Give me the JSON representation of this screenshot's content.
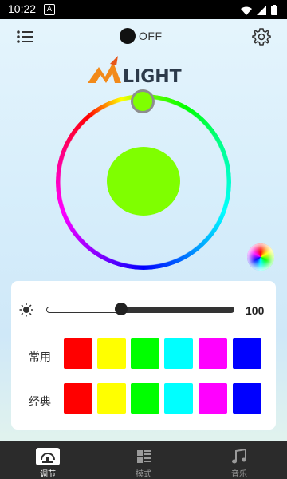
{
  "status_bar": {
    "time": "10:22"
  },
  "header": {
    "power_label": "OFF"
  },
  "logo": {
    "text": "LIGHT",
    "letter": "M"
  },
  "color_wheel": {
    "selected_color": "#7fff00"
  },
  "brightness": {
    "value": "100",
    "level_fraction": 0.4
  },
  "rows": [
    {
      "label": "常用",
      "colors": [
        "#ff0000",
        "#ffff00",
        "#00ff00",
        "#00ffff",
        "#ff00ff",
        "#0000ff"
      ]
    },
    {
      "label": "经典",
      "colors": [
        "#ff0000",
        "#ffff00",
        "#00ff00",
        "#00ffff",
        "#ff00ff",
        "#0000ff"
      ]
    }
  ],
  "nav": [
    {
      "label": "调节",
      "icon": "adjust-icon",
      "active": true
    },
    {
      "label": "模式",
      "icon": "mode-icon",
      "active": false
    },
    {
      "label": "音乐",
      "icon": "music-icon",
      "active": false
    }
  ]
}
